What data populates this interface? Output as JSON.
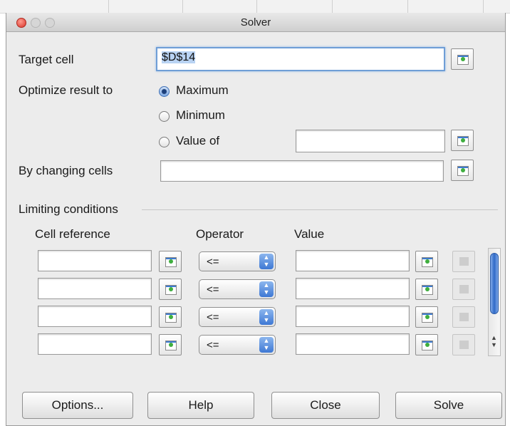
{
  "window": {
    "title": "Solver"
  },
  "target_cell": {
    "label": "Target cell",
    "value": "$D$14"
  },
  "optimize": {
    "label": "Optimize result to",
    "options": [
      {
        "label": "Maximum",
        "selected": true
      },
      {
        "label": "Minimum",
        "selected": false
      },
      {
        "label": "Value of",
        "selected": false
      }
    ],
    "value_of": ""
  },
  "changing_cells": {
    "label": "By changing cells",
    "value": ""
  },
  "limiting": {
    "title": "Limiting conditions",
    "headers": {
      "cell_reference": "Cell reference",
      "operator": "Operator",
      "value": "Value"
    },
    "rows": [
      {
        "cell_reference": "",
        "operator": "<=",
        "value": ""
      },
      {
        "cell_reference": "",
        "operator": "<=",
        "value": ""
      },
      {
        "cell_reference": "",
        "operator": "<=",
        "value": ""
      },
      {
        "cell_reference": "",
        "operator": "<=",
        "value": ""
      }
    ]
  },
  "buttons": {
    "options": "Options...",
    "help": "Help",
    "close": "Close",
    "solve": "Solve"
  },
  "icons": {
    "shrink": "shrink-selection-icon",
    "remove": "remove-condition-icon",
    "dropdown": "dropdown-arrows-icon"
  },
  "colors": {
    "accent": "#3e78d4",
    "focus": "#6f9ed6",
    "selection": "#b9d3f3"
  }
}
